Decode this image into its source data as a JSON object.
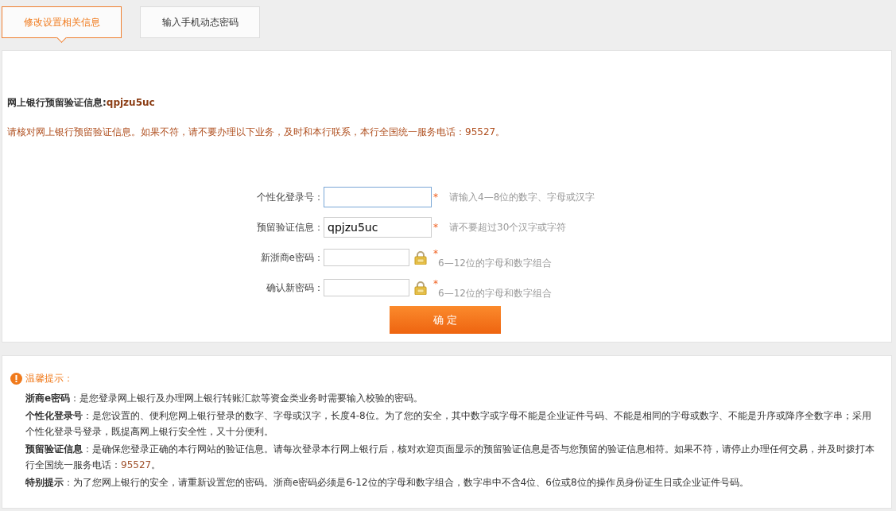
{
  "tabs": [
    {
      "label": "修改设置相关信息",
      "selected": true
    },
    {
      "label": "输入手机动态密码",
      "selected": false
    }
  ],
  "verify": {
    "label": "网上银行预留验证信息:",
    "value": "qpjzu5uc"
  },
  "notice": "请核对网上银行预留验证信息。如果不符，请不要办理以下业务，及时和本行联系，本行全国统一服务电话：95527。",
  "form": {
    "fields": [
      {
        "kind": "text",
        "label": "个性化登录号：",
        "focused": true,
        "required": "*",
        "hint": "请输入4—8位的数字、字母或汉字"
      },
      {
        "kind": "text",
        "label": "预留验证信息：",
        "value": "qpjzu5uc",
        "focused": false,
        "required": "*",
        "hint": "请不要超过30个汉字或字符"
      },
      {
        "kind": "password",
        "label": "新浙商e密码：",
        "focused": false,
        "required": "*",
        "hint": "6—12位的字母和数字组合"
      },
      {
        "kind": "password",
        "label": "确认新密码：",
        "focused": false,
        "required": "*",
        "hint": "6—12位的字母和数字组合"
      }
    ],
    "submit": "确 定"
  },
  "tips": {
    "title": "温馨提示：",
    "items": [
      {
        "label": "浙商e密码",
        "text": "：是您登录网上银行及办理网上银行转账汇款等资金类业务时需要输入校验的密码。"
      },
      {
        "label": "个性化登录号",
        "text": "：是您设置的、便利您网上银行登录的数字、字母或汉字，长度4-8位。为了您的安全，其中数字或字母不能是企业证件号码、不能是相同的字母或数字、不能是升序或降序全数字串；采用个性化登录号登录，既提高网上银行安全性，又十分便利。"
      },
      {
        "label": "预留验证信息",
        "text": "：是确保您登录正确的本行网站的验证信息。请每次登录本行网上银行后，核对欢迎页面显示的预留验证信息是否与您预留的验证信息相符。如果不符，请停止办理任何交易，并及时拨打本行全国统一服务电话：",
        "phone": "95527",
        "end": "。"
      },
      {
        "label": "特别提示",
        "text": "：为了您网上银行的安全，请重新设置您的密码。浙商e密码必须是6-12位的字母和数字组合，数字串中不含4位、6位或8位的操作员身份证生日或企业证件号码。"
      }
    ]
  }
}
